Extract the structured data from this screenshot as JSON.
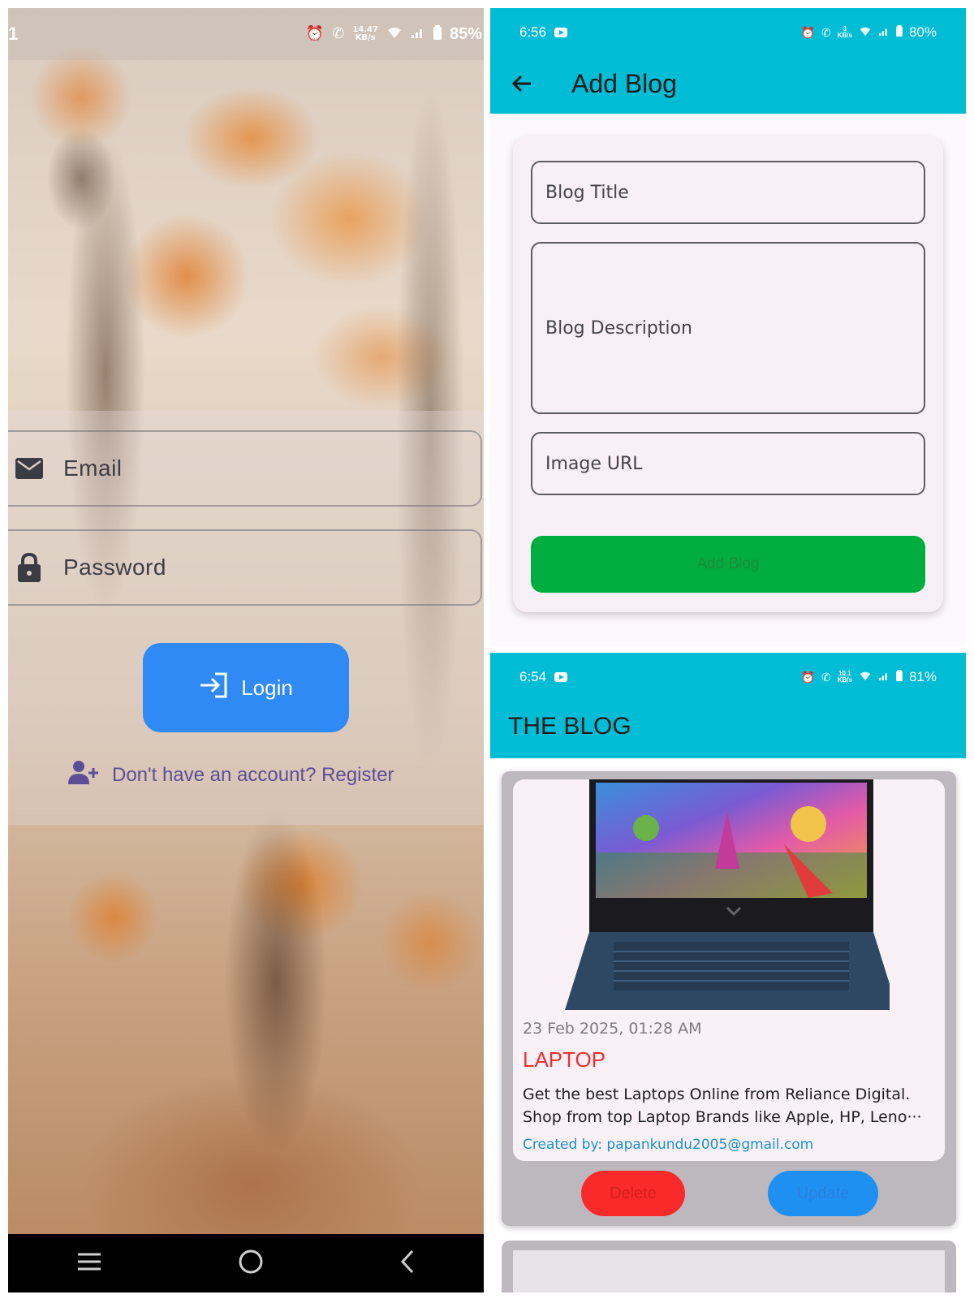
{
  "login": {
    "status_bar": {
      "time_fragment": "1",
      "speed_top": "14.47",
      "speed_bottom": "KB/s",
      "battery": "85%"
    },
    "email_label": "Email",
    "password_label": "Password",
    "login_label": "Login",
    "register_text": "Don't have an account? Register",
    "icons": {
      "email": "mail-icon",
      "password": "lock-icon",
      "login": "login-arrow-icon",
      "register": "person-add-icon",
      "nav_menu": "menu-lines-icon",
      "nav_home": "home-circle-icon",
      "nav_back": "back-chevron-icon"
    }
  },
  "add_blog": {
    "status_bar": {
      "time": "6:56",
      "speed_top": "3",
      "speed_bottom": "KB/s",
      "battery": "80%"
    },
    "title": "Add Blog",
    "fields": {
      "title_label": "Blog Title",
      "description_label": "Blog Description",
      "image_url_label": "Image URL"
    },
    "submit_label": "Add Blog",
    "colors": {
      "appbar": "#00bcd4",
      "submit": "#00ad3f"
    }
  },
  "blog_list": {
    "status_bar": {
      "time": "6:54",
      "speed_top": "10.1",
      "speed_bottom": "KB/s",
      "battery": "81%"
    },
    "title": "THE BLOG",
    "posts": [
      {
        "date": "23 Feb 2025, 01:28 AM",
        "title": "LAPTOP",
        "description_line1": "Get the best Laptops Online from Reliance Digital.",
        "description_line2": "Shop from top Laptop Brands like Apple, HP, Leno···",
        "author": "Created by: papankundu2005@gmail.com",
        "delete_label": "Delete",
        "update_label": "Update"
      }
    ]
  }
}
